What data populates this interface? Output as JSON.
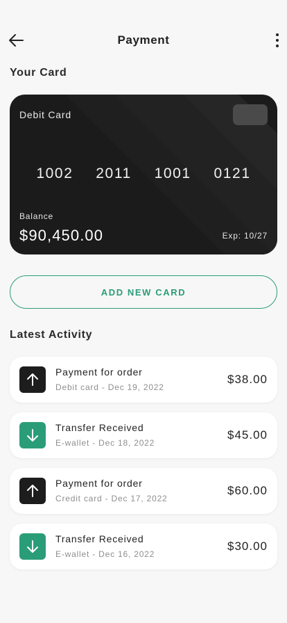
{
  "header": {
    "title": "Payment",
    "back_icon": "arrow-left-icon",
    "more_icon": "more-vertical-icon"
  },
  "card_section": {
    "title": "Your Card"
  },
  "card": {
    "type": "Debit Card",
    "number_groups": [
      "1002",
      "2011",
      "1001",
      "0121"
    ],
    "balance_label": "Balance",
    "balance": "$90,450.00",
    "expiry": "Exp: 10/27",
    "color": "#1b1b1b"
  },
  "add_card": {
    "label": "ADD NEW CARD",
    "accent_color": "#2a9d78"
  },
  "activity": {
    "title": "Latest Activity",
    "items": [
      {
        "title": "Payment for order",
        "subtitle": "Debit card - Dec 19, 2022",
        "amount": "$38.00",
        "icon": "arrow-up-icon",
        "tone": "dark"
      },
      {
        "title": "Transfer Received",
        "subtitle": "E-wallet - Dec 18, 2022",
        "amount": "$45.00",
        "icon": "arrow-down-icon",
        "tone": "green"
      },
      {
        "title": "Payment for order",
        "subtitle": "Credit card - Dec 17, 2022",
        "amount": "$60.00",
        "icon": "arrow-up-icon",
        "tone": "dark"
      },
      {
        "title": "Transfer Received",
        "subtitle": "E-wallet - Dec 16, 2022",
        "amount": "$30.00",
        "icon": "arrow-down-icon",
        "tone": "green"
      }
    ]
  }
}
